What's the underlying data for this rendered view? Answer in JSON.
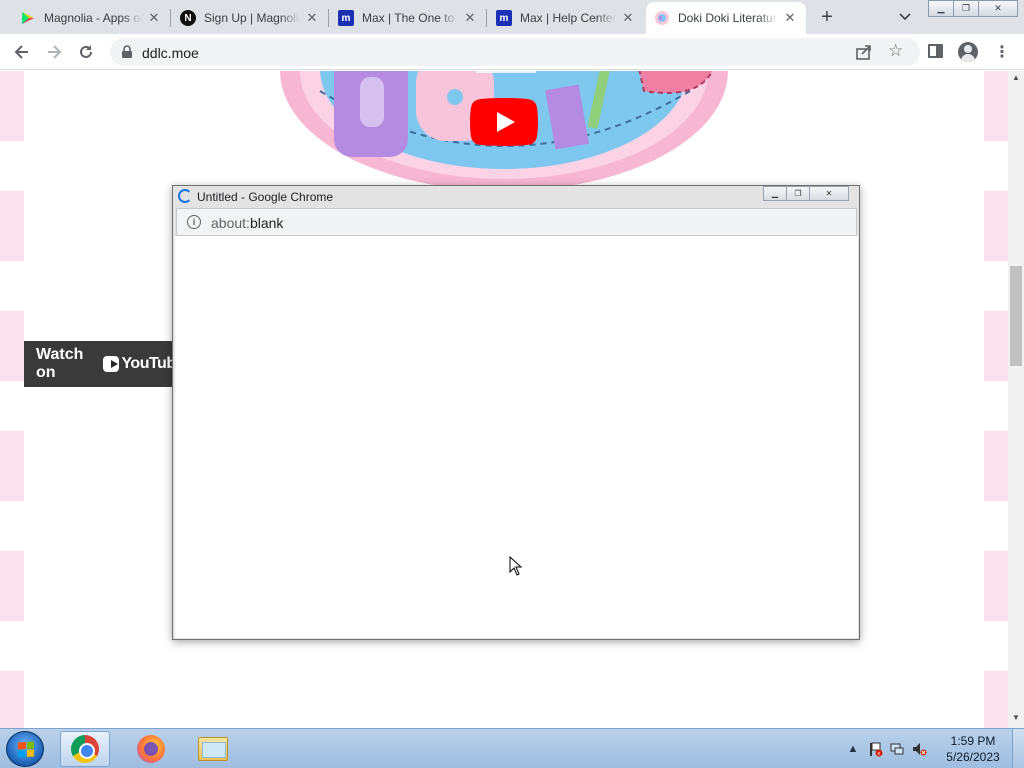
{
  "browser": {
    "tabs": [
      {
        "title": "Magnolia - Apps on Google Play",
        "favicon": "google-play-icon",
        "active": false
      },
      {
        "title": "Sign Up | Magnolia",
        "favicon": "magnolia-icon",
        "active": false
      },
      {
        "title": "Max | The One to Watch",
        "favicon": "max-icon",
        "active": false
      },
      {
        "title": "Max | Help Center",
        "favicon": "max-icon",
        "active": false
      },
      {
        "title": "Doki Doki Literature Club",
        "favicon": "ddlc-icon",
        "active": true
      }
    ],
    "new_tab_label": "+",
    "address": "ddlc.moe"
  },
  "page": {
    "watch_on_label": "Watch on",
    "youtube_label": "YouTube"
  },
  "popup": {
    "title": "Untitled - Google Chrome",
    "url_scheme": "about:",
    "url_host": "blank"
  },
  "taskbar": {
    "pinned": [
      "chrome-icon",
      "firefox-icon",
      "file-explorer-icon"
    ],
    "time": "1:59 PM",
    "date": "5/26/2023"
  },
  "colors": {
    "tabstrip": "#dee1e6",
    "page_stripe": "#fbe0ee",
    "youtube_red": "#ff0000",
    "taskbar": "#b9d1ea"
  }
}
